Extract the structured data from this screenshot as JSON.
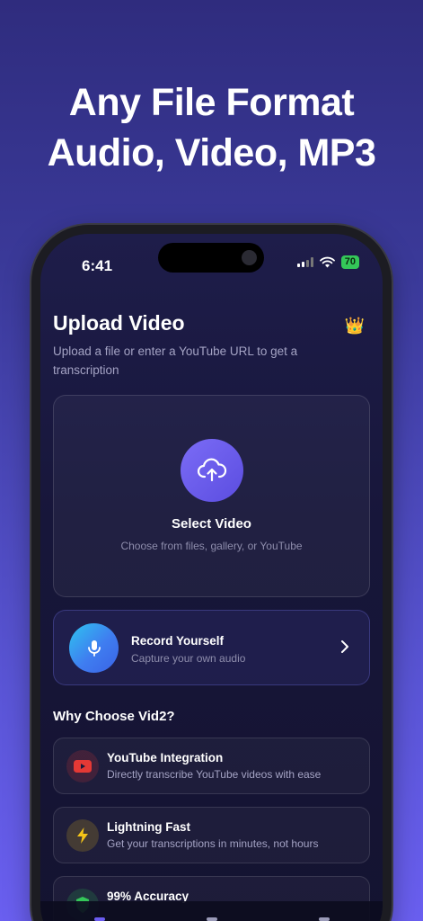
{
  "promo": {
    "line1": "Any File Format",
    "line2": "Audio, Video, MP3"
  },
  "status_bar": {
    "time": "6:41",
    "battery": "70"
  },
  "header": {
    "title": "Upload Video",
    "subtitle": "Upload a file or enter a YouTube URL to get a transcription",
    "premium_icon": "crown-icon"
  },
  "upload_card": {
    "icon": "cloud-upload-icon",
    "title": "Select Video",
    "subtitle": "Choose from files, gallery, or YouTube"
  },
  "record_card": {
    "icon": "microphone-icon",
    "title": "Record Yourself",
    "subtitle": "Capture your own audio"
  },
  "why_section": {
    "title": "Why Choose Vid2?",
    "features": [
      {
        "icon": "youtube-icon",
        "title": "YouTube Integration",
        "subtitle": "Directly transcribe YouTube videos with ease"
      },
      {
        "icon": "lightning-icon",
        "title": "Lightning Fast",
        "subtitle": "Get your transcriptions in minutes, not hours"
      },
      {
        "icon": "shield-icon",
        "title": "99% Accuracy",
        "subtitle": ""
      }
    ]
  },
  "colors": {
    "accent_purple": "#6b5cf0",
    "accent_blue": "#3f7df0",
    "youtube_red": "#e53935",
    "lightning_yellow": "#f5c518",
    "battery_green": "#34c759"
  }
}
